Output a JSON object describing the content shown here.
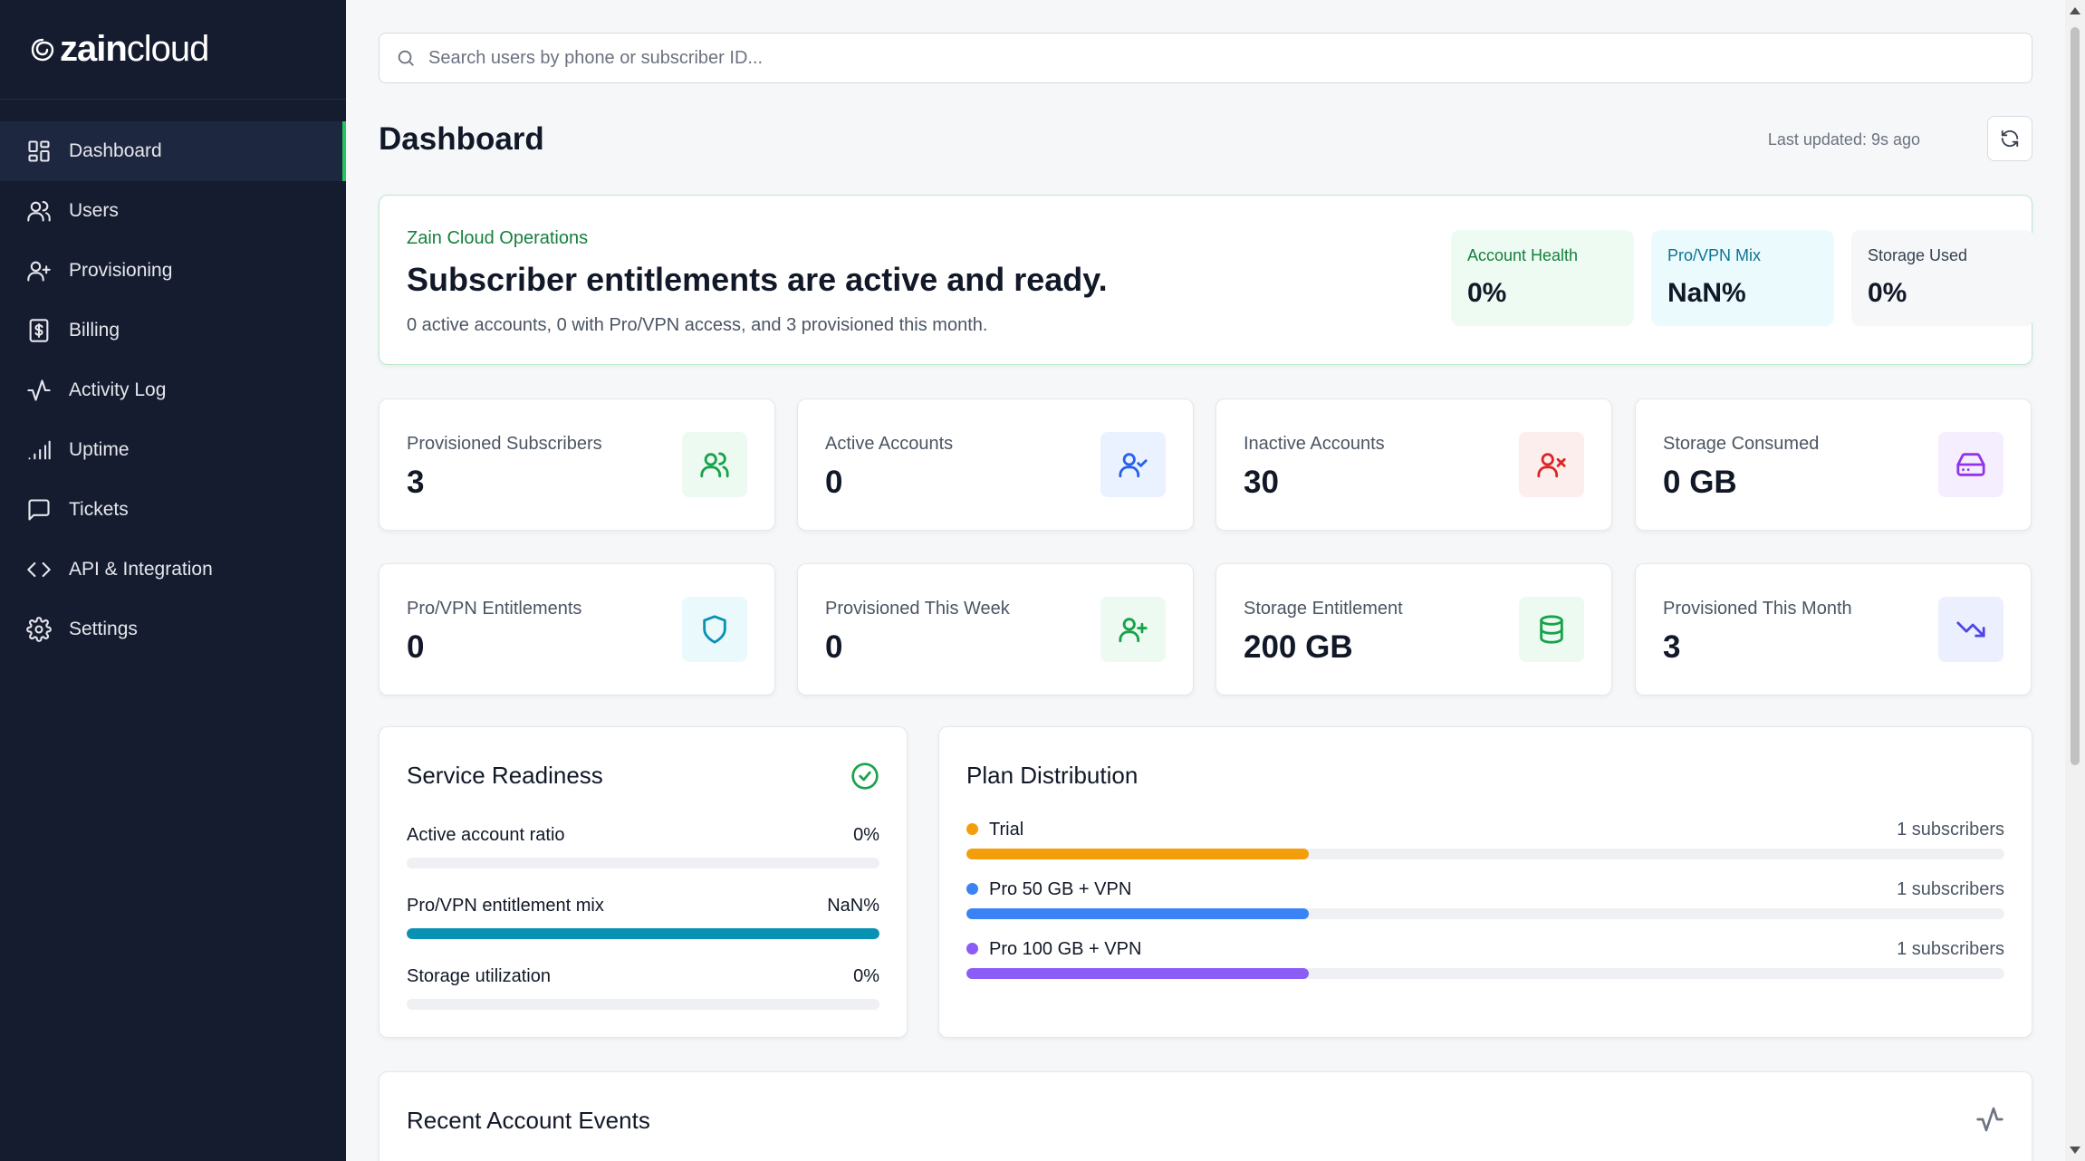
{
  "brand": {
    "bold": "zain",
    "light": "cloud"
  },
  "sidebar": {
    "items": [
      {
        "label": "Dashboard",
        "icon": "grid-icon",
        "active": true
      },
      {
        "label": "Users",
        "icon": "users-icon"
      },
      {
        "label": "Provisioning",
        "icon": "user-plus-icon"
      },
      {
        "label": "Billing",
        "icon": "receipt-icon"
      },
      {
        "label": "Activity Log",
        "icon": "activity-icon"
      },
      {
        "label": "Uptime",
        "icon": "signal-icon"
      },
      {
        "label": "Tickets",
        "icon": "message-icon"
      },
      {
        "label": "API & Integration",
        "icon": "code-icon"
      },
      {
        "label": "Settings",
        "icon": "gear-icon"
      }
    ]
  },
  "search": {
    "placeholder": "Search users by phone or subscriber ID...",
    "value": ""
  },
  "header": {
    "title": "Dashboard",
    "last_updated": "Last updated: 9s ago"
  },
  "hero": {
    "kicker": "Zain Cloud Operations",
    "title": "Subscriber entitlements are active and ready.",
    "subtitle": "0 active accounts, 0 with Pro/VPN access, and 3 provisioned this month.",
    "stats": [
      {
        "label": "Account Health",
        "value": "0%"
      },
      {
        "label": "Pro/VPN Mix",
        "value": "NaN%"
      },
      {
        "label": "Storage Used",
        "value": "0%"
      }
    ]
  },
  "cards": [
    {
      "label": "Provisioned Subscribers",
      "value": "3",
      "icon": "users-icon",
      "color": "#16a34a"
    },
    {
      "label": "Active Accounts",
      "value": "0",
      "icon": "user-check-icon",
      "color": "#2563eb"
    },
    {
      "label": "Inactive Accounts",
      "value": "30",
      "icon": "user-x-icon",
      "color": "#dc2626"
    },
    {
      "label": "Storage Consumed",
      "value": "0 GB",
      "icon": "hard-drive-icon",
      "color": "#9333ea"
    },
    {
      "label": "Pro/VPN Entitlements",
      "value": "0",
      "icon": "shield-icon",
      "color": "#0891b2"
    },
    {
      "label": "Provisioned This Week",
      "value": "0",
      "icon": "user-plus-icon",
      "color": "#16a34a"
    },
    {
      "label": "Storage Entitlement",
      "value": "200 GB",
      "icon": "database-icon",
      "color": "#16a34a"
    },
    {
      "label": "Provisioned This Month",
      "value": "3",
      "icon": "trending-down-icon",
      "color": "#4f46e5"
    }
  ],
  "readiness": {
    "title": "Service Readiness",
    "rows": [
      {
        "name": "Active account ratio",
        "pct": "0%",
        "fraction": 0,
        "color": "#16a34a"
      },
      {
        "name": "Pro/VPN entitlement mix",
        "pct": "NaN%",
        "fraction": 1,
        "color": "#0891b2"
      },
      {
        "name": "Storage utilization",
        "pct": "0%",
        "fraction": 0,
        "color": "#9333ea"
      }
    ]
  },
  "plan": {
    "title": "Plan Distribution",
    "rows": [
      {
        "name": "Trial",
        "count": "1 subscribers",
        "fraction": 0.33,
        "color": "#f59e0b"
      },
      {
        "name": "Pro 50 GB + VPN",
        "count": "1 subscribers",
        "fraction": 0.33,
        "color": "#3b82f6"
      },
      {
        "name": "Pro 100 GB + VPN",
        "count": "1 subscribers",
        "fraction": 0.33,
        "color": "#8b5cf6"
      }
    ]
  },
  "events": {
    "title": "Recent Account Events"
  }
}
